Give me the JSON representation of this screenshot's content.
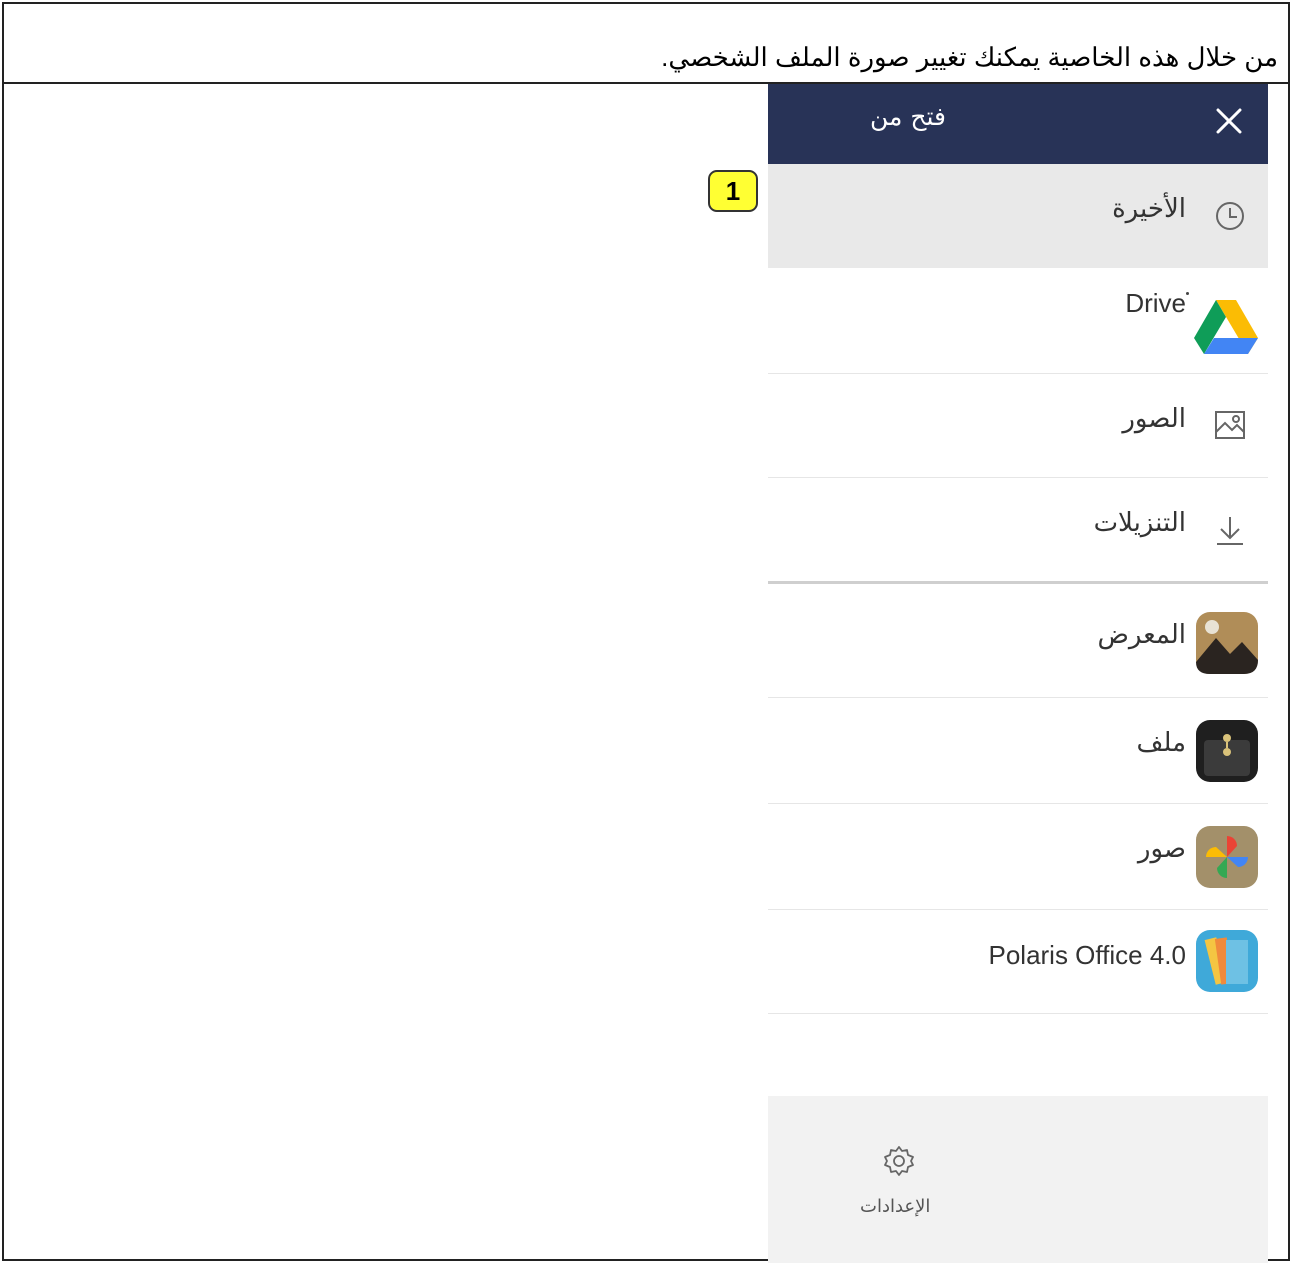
{
  "caption": "من خلال هذه الخاصية يمكنك تغيير صورة الملف الشخصي.",
  "picker": {
    "title": "فتح من",
    "items": [
      {
        "label": "الأخيرة",
        "icon": "clock-icon"
      },
      {
        "label": "Drive",
        "icon": "google-drive-icon"
      },
      {
        "label": "الصور",
        "icon": "image-icon"
      },
      {
        "label": "التنزيلات",
        "icon": "download-icon"
      }
    ],
    "apps": [
      {
        "label": "المعرض",
        "icon": "gallery-app-icon"
      },
      {
        "label": "ملف",
        "icon": "file-manager-app-icon"
      },
      {
        "label": "صور",
        "icon": "google-photos-icon"
      },
      {
        "label": "Polaris Office 4.0",
        "icon": "polaris-office-icon"
      }
    ],
    "settings_label": "الإعدادات"
  },
  "annotation_badge": "1",
  "colors": {
    "header": "#283357",
    "selected_row": "#e9e9e9",
    "badge": "#ffff33"
  }
}
